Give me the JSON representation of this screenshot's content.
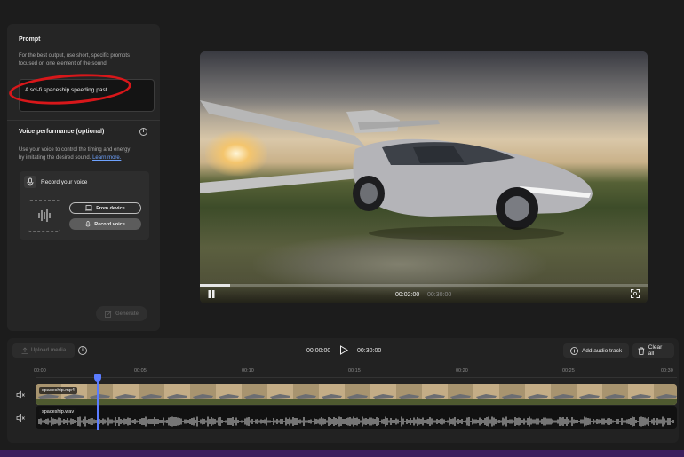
{
  "left_panel": {
    "prompt_title": "Prompt",
    "prompt_help_line1": "For the best output, use short, specific prompts",
    "prompt_help_line2": "focused on one element of the sound.",
    "prompt_value": "A sci-fi spaceship speeding past",
    "voice_title": "Voice performance (optional)",
    "voice_help_line1": "Use your voice to control the timing and energy",
    "voice_help_line2": "by imitating the desired sound.",
    "learn_more": "Learn more.",
    "record_title": "Record your voice",
    "from_device": "From device",
    "record_voice": "Record voice",
    "generate": "Generate"
  },
  "video": {
    "current_time": "00:02:00",
    "duration": "00:30:00",
    "progress": 0.067
  },
  "timeline": {
    "upload_media": "Upload media",
    "current_time": "00:00:00",
    "total_time": "00:30:00",
    "add_audio_track": "Add audio track",
    "clear_all": "Clear all",
    "ruler": [
      "00:00",
      "00:05",
      "00:10",
      "00:15",
      "00:20",
      "00:25",
      "00:30"
    ],
    "video_track_label": "spaceship.mp4",
    "audio_track_label": "spaceship.wav"
  },
  "colors": {
    "accent": "#5b7cff",
    "annotation": "#d8171a",
    "link": "#6ea2ff"
  }
}
